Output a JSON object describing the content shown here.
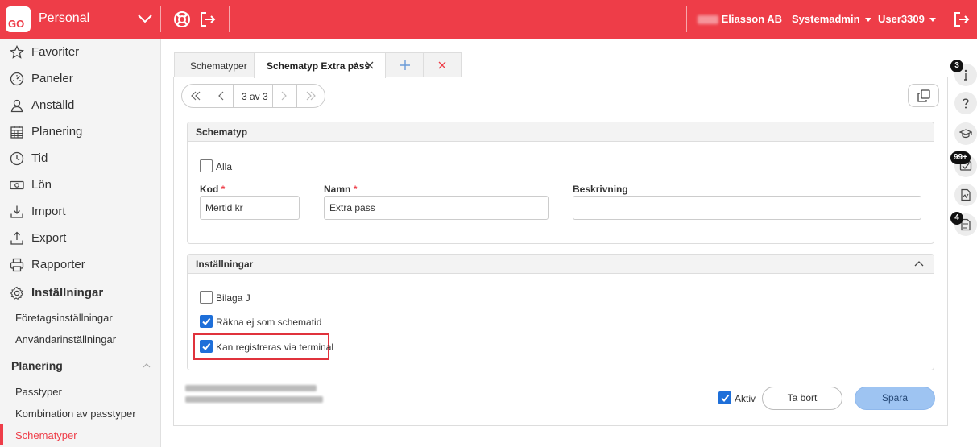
{
  "topbar": {
    "logo_text": "GO",
    "app_title": "Personal",
    "company": "Eliasson AB",
    "role": "Systemadmin",
    "user": "User3309"
  },
  "sidebar": {
    "items": [
      {
        "label": "Favoriter",
        "icon": "star-icon"
      },
      {
        "label": "Paneler",
        "icon": "gauge-icon"
      },
      {
        "label": "Anställd",
        "icon": "person-icon"
      },
      {
        "label": "Planering",
        "icon": "calendar-icon"
      },
      {
        "label": "Tid",
        "icon": "clock-icon"
      },
      {
        "label": "Lön",
        "icon": "money-icon"
      },
      {
        "label": "Import",
        "icon": "import-icon"
      },
      {
        "label": "Export",
        "icon": "export-icon"
      },
      {
        "label": "Rapporter",
        "icon": "printer-icon"
      },
      {
        "label": "Inställningar",
        "icon": "gear-icon"
      }
    ],
    "settings_sub": [
      "Företagsinställningar",
      "Användarinställningar"
    ],
    "section": "Planering",
    "planning_sub": [
      "Passtyper",
      "Kombination av passtyper",
      "Schematyper"
    ]
  },
  "tabs": {
    "tab1": "Schematyper",
    "tab2": "Schematyp Extra pass",
    "tab2_marker": "*"
  },
  "pager": {
    "count": "3 av 3"
  },
  "schematyp": {
    "title": "Schematyp",
    "all_label": "Alla",
    "code_label": "Kod",
    "code_value": "Mertid kr",
    "name_label": "Namn",
    "name_value": "Extra pass",
    "desc_label": "Beskrivning",
    "desc_value": "",
    "required_marker": "*"
  },
  "settings": {
    "title": "Inställningar",
    "bilaga": "Bilaga J",
    "rakna": "Räkna ej som schematid",
    "terminal": "Kan registreras via terminal"
  },
  "footer": {
    "active_label": "Aktiv",
    "delete_label": "Ta bort",
    "save_label": "Spara"
  },
  "rail": {
    "badge_info": "3",
    "badge_messages": "99+",
    "badge_docs": "4"
  },
  "colors": {
    "brand": "#ee3d48",
    "checkbox": "#1e6fd9",
    "save_button": "#9ec4f2"
  }
}
